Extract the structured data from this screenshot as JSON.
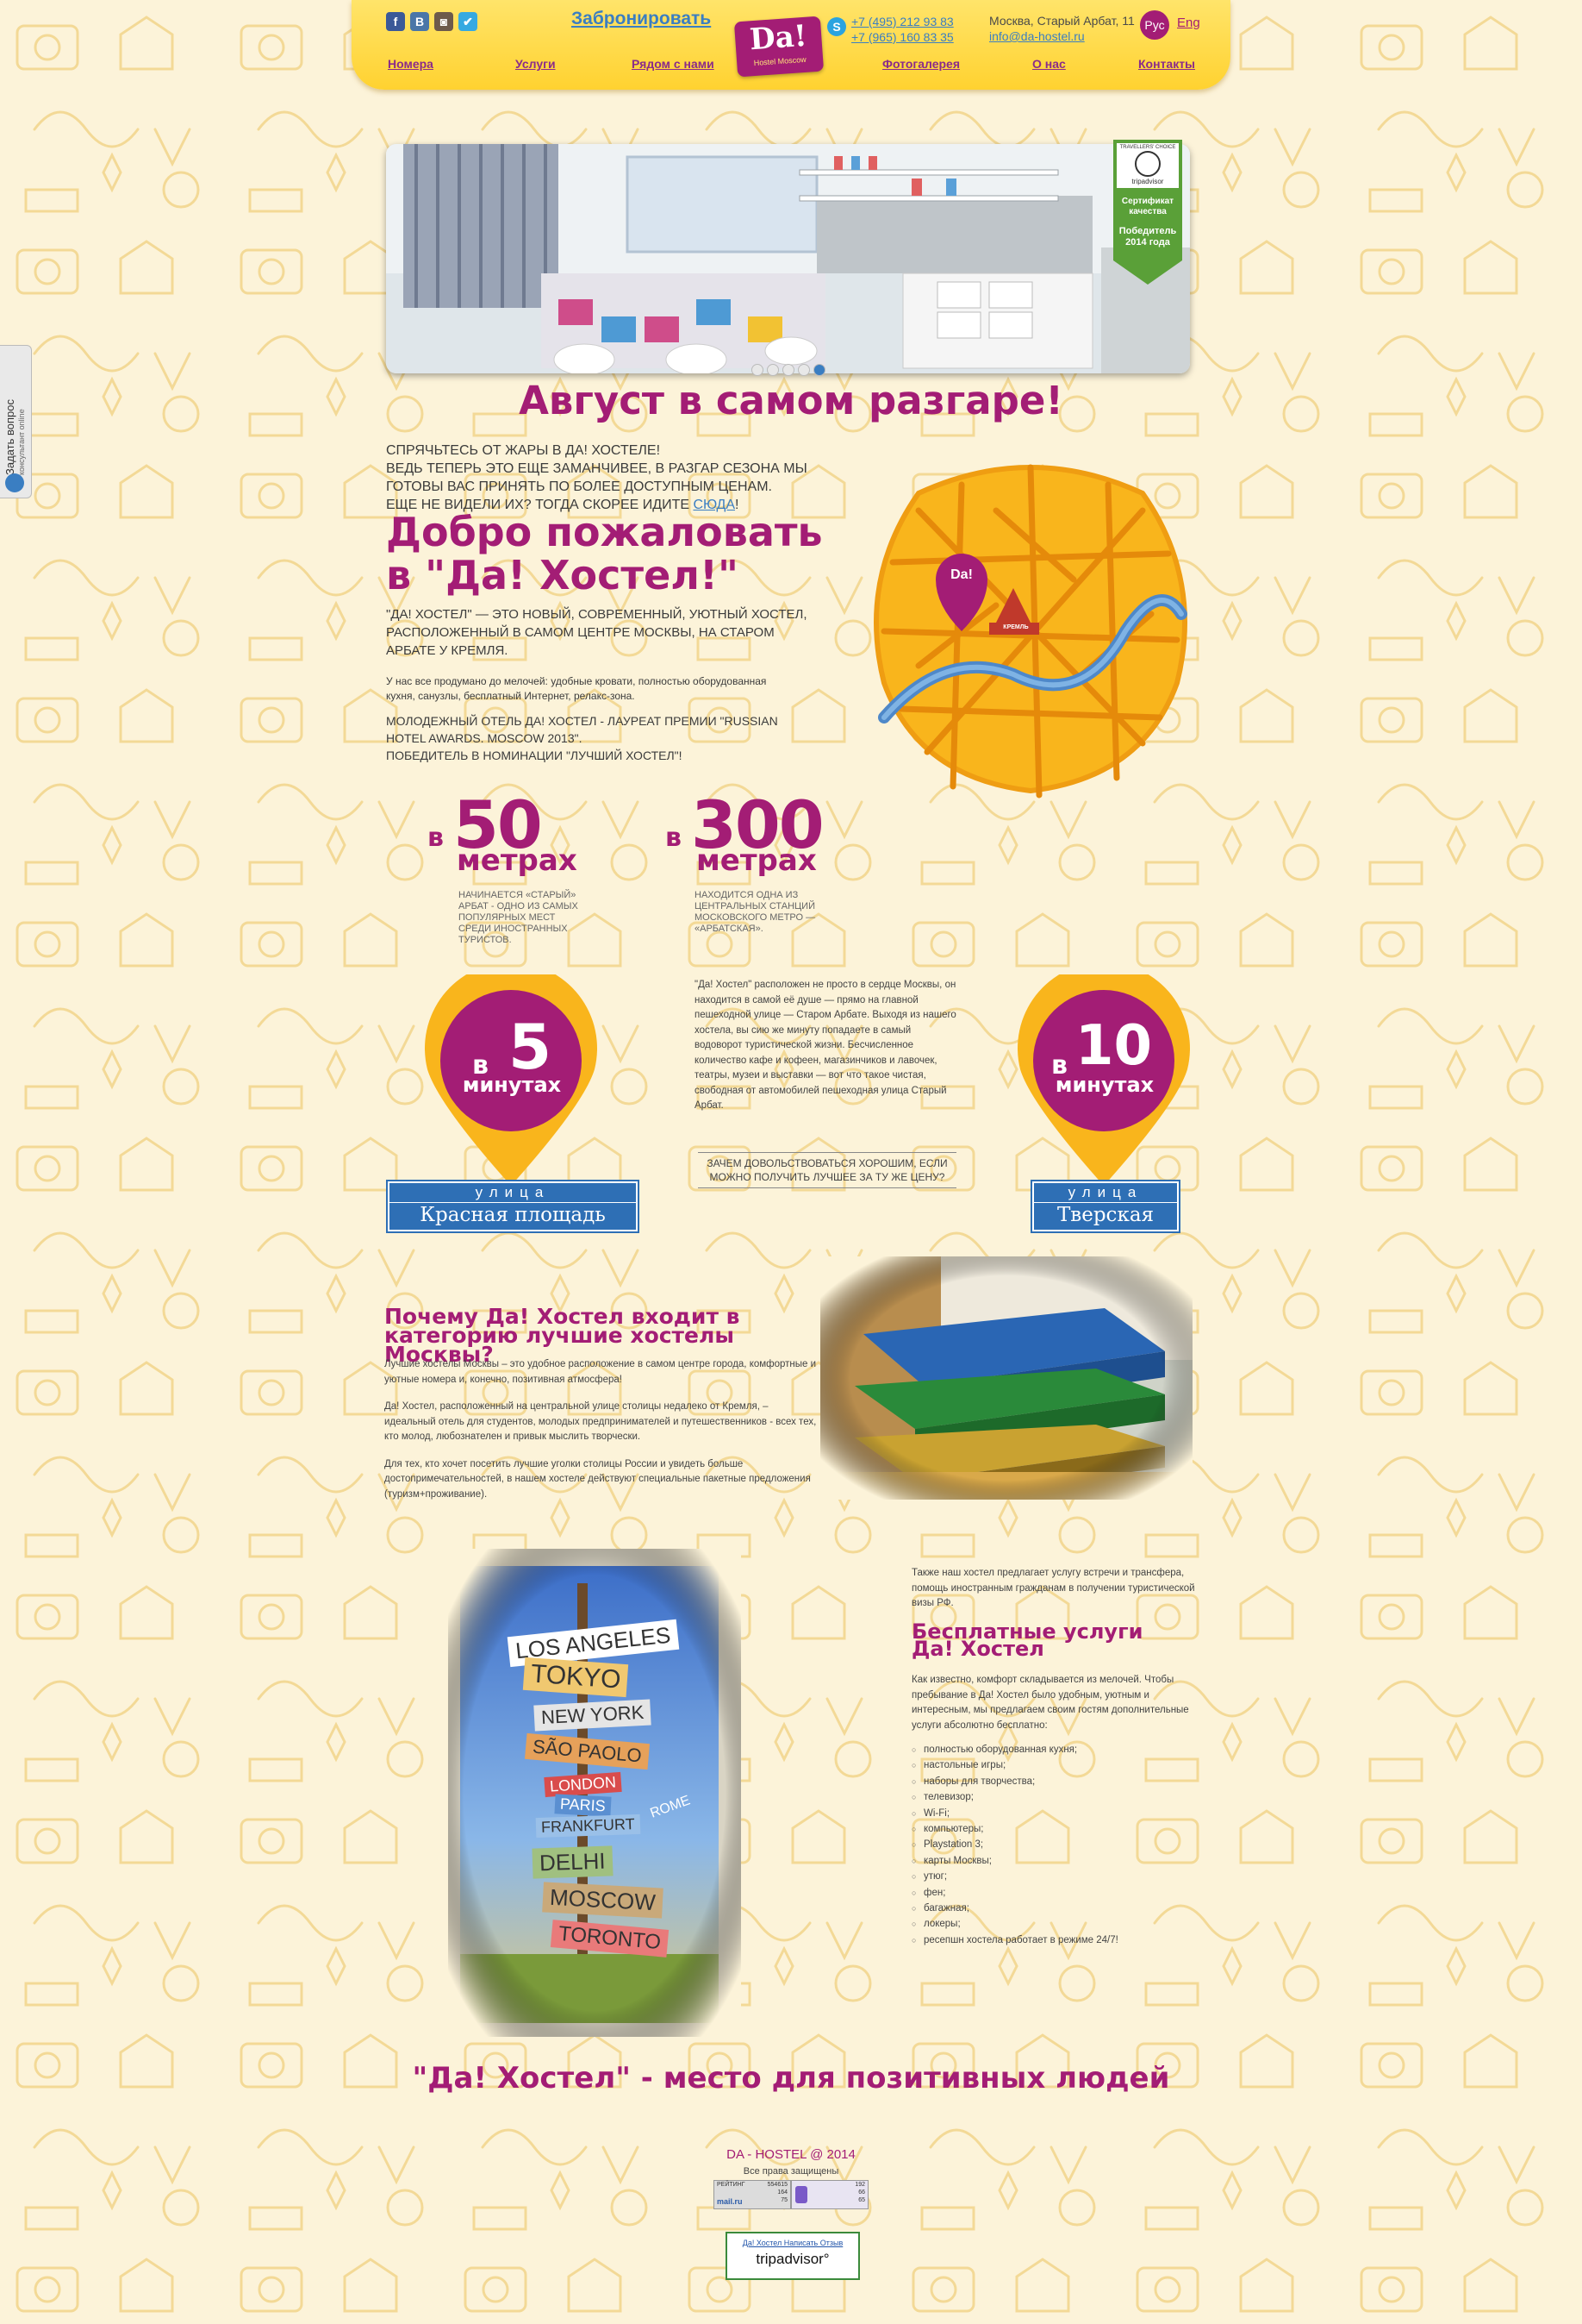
{
  "header": {
    "book_label": "Забронировать",
    "logo_text": "Da!",
    "logo_sub": "Hostel Moscow",
    "phone1": "+7 (495) 212 93 83",
    "phone2": "+7 (965) 160 83 35",
    "address": "Москва, Старый Арбат, 11",
    "email": "info@da-hostel.ru",
    "lang_ru": "Рус",
    "lang_en": "Eng",
    "social": [
      "f",
      "В",
      "◙",
      "✔"
    ],
    "nav": [
      "Номера",
      "Услуги",
      "Рядом с нами",
      "Фотогалерея",
      "О нас",
      "Контакты"
    ]
  },
  "slider": {
    "cert_title": "TRAVELLERS' CHOICE",
    "cert_brand": "tripadvisor",
    "cert_label": "Сертификат качества",
    "cert_winner": "Победитель 2014 года"
  },
  "side_tab": {
    "title": "Задать вопрос",
    "subtitle": "консультант online"
  },
  "promo": {
    "heading": "Август в самом разгаре!",
    "line1": "Спрячьтесь от жары в Да! Хостеле!",
    "line2": "Ведь теперь это еще заманчивее, в разгар сезона мы готовы вас принять по более доступным ценам.",
    "line3": "Еще не видели их? Тогда скорее идите ",
    "link": "сюда",
    "line3_end": "!"
  },
  "welcome": {
    "title_line1": "Добро пожаловать",
    "title_line2": "в \"Да! Хостел!\"",
    "about": "\"Да! Хостел\" — это новый, современный, уютный хостел, расположенный в самом центре Москвы, на Старом Арбате у Кремля.",
    "about_small": "У нас все продумано до мелочей: удобные кровати, полностью оборудованная кухня, санузлы, бесплатный Интернет, релакс-зона.",
    "award1": "Молодежный отель Да! Хостел - лауреат премии \"Russian Hotel Awards. Moscow 2013\".",
    "award2": "Победитель в номинации \"Лучший хостел\"!"
  },
  "map": {
    "pin_label": "Da!",
    "kremlin_label": "КРЕМЛЬ"
  },
  "distances": [
    {
      "pre": "в",
      "num": "50",
      "unit": "метрах",
      "desc": "Начинается «Старый» Арбат - одно из самых популярных мест среди иностранных туристов."
    },
    {
      "pre": "в",
      "num": "300",
      "unit": "метрах",
      "desc": "Находится одна из центральных станций московского метро — «Арбатская»."
    }
  ],
  "pins": [
    {
      "pre": "в",
      "num": "5",
      "unit": "минутах",
      "street_label": "улица",
      "street_name": "Красная площадь"
    },
    {
      "pre": "в",
      "num": "10",
      "unit": "минутах",
      "street_label": "улица",
      "street_name": "Тверская"
    }
  ],
  "center": {
    "text": "\"Да! Хостел\" расположен не просто в сердце Москвы, он находится в самой её душе — прямо на главной пешеходной улице — Старом Арбате. Выходя из нашего хостела, вы сию же минуту попадаете в самый водоворот туристической жизни. Бесчисленное количество кафе и кофеен, магазинчиков и лавочек, театры, музеи и выставки — вот что такое чистая, свободная от автомобилей пешеходная улица Старый Арбат.",
    "quote": "Зачем довольствоваться хорошим, если можно получить лучшее за ту же цену?"
  },
  "why": {
    "title": "Почему Да! Хостел входит в категорию лучшие хостелы Москвы?",
    "p1": "Лучшие хостелы Москвы – это удобное расположение в самом центре города, комфортные и уютные номера и, конечно, позитивная атмосфера!",
    "p2": "Да! Хостел, расположенный на центральной улице столицы недалеко от Кремля, – идеальный отель для студентов, молодых предпринимателей и путешественников - всех тех, кто молод, любознателен и привык мыслить творчески.",
    "p3": "Для тех, кто хочет посетить лучшие уголки столицы России и увидеть больше достопримечательностей, в нашем хостеле действуют специальные пакетные предложения (туризм+проживание)."
  },
  "signs": [
    "LOS ANGELES",
    "TOKYO",
    "NEW YORK",
    "SÃO PAOLO",
    "LONDON",
    "PARIS",
    "FRANKFURT",
    "ROME",
    "DELHI",
    "MOSCOW",
    "TORONTO"
  ],
  "services": {
    "top": "Также наш хостел предлагает услугу встречи и трансфера, помощь иностранным гражданам в получении туристической визы РФ.",
    "title": "Бесплатные услуги Да! Хостел",
    "intro": "Как известно, комфорт складывается из мелочей. Чтобы пребывание в Да! Хостел было удобным, уютным и интересным, мы предлагаем своим гостям дополнительные услуги абсолютно бесплатно:",
    "items": [
      "полностью оборудованная кухня;",
      "настольные игры;",
      "наборы для творчества;",
      "телевизор;",
      "Wi-Fi;",
      "компьютеры;",
      "Playstation 3;",
      "карты Москвы;",
      "утюг;",
      "фен;",
      "багажная;",
      "локеры;",
      "ресепшн хостела работает в режиме 24/7!"
    ]
  },
  "footer": {
    "slogan": "\"Да! Хостел\" - место для позитивных людей",
    "copyright": "DA - HOSTEL @ 2014",
    "rights": "Все права защищены",
    "counter_left": "РЕЙТИНГ",
    "counter_values": [
      "554615",
      "164",
      "75"
    ],
    "counter_right": [
      "192",
      "66",
      "65"
    ],
    "counter_brand": "mail.ru",
    "ta_link": "Да! Хостел Написать Отзыв",
    "ta_brand": "tripadvisor°"
  },
  "colors": {
    "accent": "#a31d75",
    "header": "#ffd230",
    "link": "#3a7ec2",
    "pin": "#f9b51c"
  }
}
